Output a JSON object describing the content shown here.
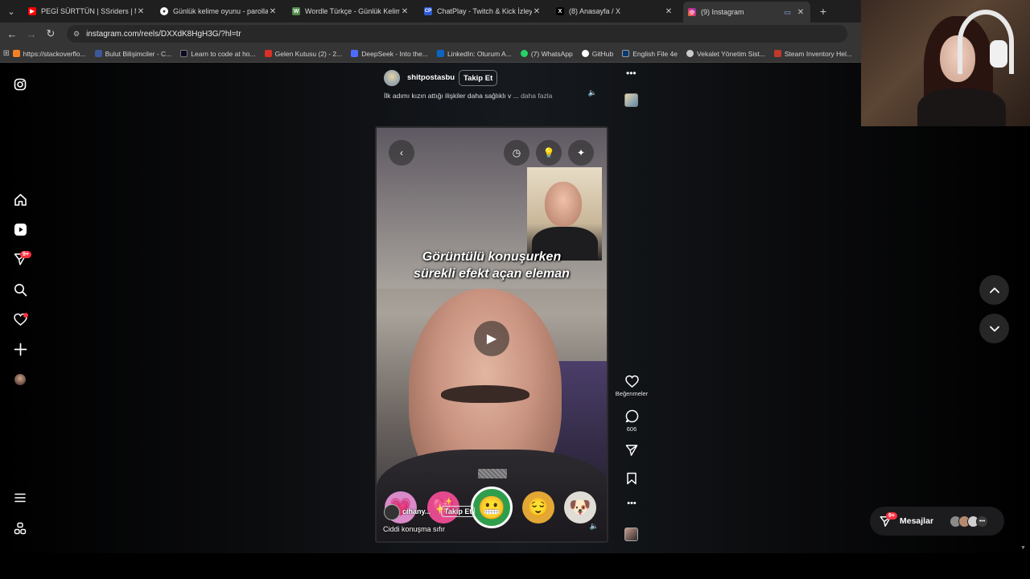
{
  "tabs": [
    {
      "title": "PEGİ SÜRTTÜN | SSriders | Moto",
      "color": "#ff0000",
      "glyph": "▶"
    },
    {
      "title": "Günlük kelime oyunu - parolla",
      "color": "#ffffff",
      "glyph": "●"
    },
    {
      "title": "Wordle Türkçe - Günlük Kelime",
      "color": "#538d4e",
      "glyph": "W"
    },
    {
      "title": "ChatPlay - Twitch & Kick İzleyici",
      "color": "#2b5bd7",
      "glyph": "CP"
    },
    {
      "title": "(8) Anasayfa / X",
      "color": "#000000",
      "glyph": "X"
    },
    {
      "title": "(9) Instagram",
      "color": "#e1306c",
      "glyph": "◎",
      "active": true
    }
  ],
  "address": {
    "url": "instagram.com/reels/DXXdK8HgH3G/?hl=tr"
  },
  "bookmarks": [
    {
      "label": "https://stackoverflo...",
      "color": "#f48024"
    },
    {
      "label": "Bulut Bilişimciler - C...",
      "color": "#3b5998"
    },
    {
      "label": "Learn to code at ho...",
      "color": "#0a0a23"
    },
    {
      "label": "Gelen Kutusu (2) - 2...",
      "color": "#d93025"
    },
    {
      "label": "DeepSeek - Into the...",
      "color": "#4d6bfe"
    },
    {
      "label": "LinkedIn: Oturum A...",
      "color": "#0a66c2"
    },
    {
      "label": "(7) WhatsApp",
      "color": "#25d366"
    },
    {
      "label": "GitHub",
      "color": "#ffffff"
    },
    {
      "label": "English File 4e",
      "color": "#003a70"
    },
    {
      "label": "Vekalet Yönetim Sist...",
      "color": "#cccccc"
    },
    {
      "label": "Steam Inventory Hel...",
      "color": "#c0392b"
    }
  ],
  "reel": {
    "username": "shitpostasbu",
    "follow_label": "Takip Et",
    "caption": "İlk adımı kızın attığı ilişkiler daha sağlıklı v ...",
    "more_label": "daha fazla",
    "overlay_line1": "Görüntülü konuşurken",
    "overlay_line2": "sürekli efekt açan eleman",
    "video_username": "cihany...",
    "video_follow": "Takip Et",
    "video_caption": "Ciddi konuşma sıfır"
  },
  "actions": {
    "like_label": "Beğenmeler",
    "comments_count": "606"
  },
  "messages": {
    "label": "Mesajlar",
    "badge": "9+"
  },
  "nav_badge": "9+",
  "accent": "#ff3040"
}
